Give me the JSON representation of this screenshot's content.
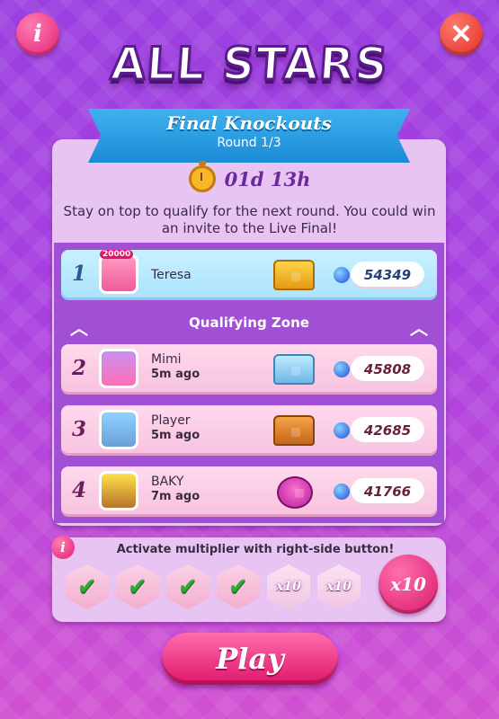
{
  "header": {
    "info_icon_glyph": "i",
    "close_icon_glyph": "✕",
    "logo_text": "ALL STARS"
  },
  "banner": {
    "title": "Final Knockouts",
    "subtitle": "Round 1/3"
  },
  "timer": {
    "value": "01d 13h",
    "icon": "stopwatch-icon"
  },
  "description": "Stay on top to qualify for the next round. You could win an invite to the Live Final!",
  "qualifying_zone_label": "Qualifying Zone",
  "leaderboard": [
    {
      "rank": "1",
      "name": "Teresa",
      "time": "",
      "score": "54349",
      "chest": "gold-chest-icon",
      "avatar_badge": "20000"
    },
    {
      "rank": "2",
      "name": "Mimi",
      "time": "5m ago",
      "score": "45808",
      "chest": "silver-chest-icon"
    },
    {
      "rank": "3",
      "name": "Player",
      "time": "5m ago",
      "score": "42685",
      "chest": "bronze-chest-icon"
    },
    {
      "rank": "4",
      "name": "BAKY",
      "time": "7m ago",
      "score": "41766",
      "chest": "candy-box-icon"
    }
  ],
  "multiplier": {
    "info_glyph": "i",
    "title": "Activate multiplier with right-side button!",
    "slots": [
      {
        "label": "✔"
      },
      {
        "label": "✔"
      },
      {
        "label": "✔"
      },
      {
        "label": "✔"
      },
      {
        "label": "x10"
      },
      {
        "label": "x10"
      }
    ],
    "button_label": "x10"
  },
  "play_button": "Play",
  "colors": {
    "accent_pink": "#e0166b",
    "ribbon_blue": "#1c8bd6",
    "background_purple": "#a83fe0"
  }
}
